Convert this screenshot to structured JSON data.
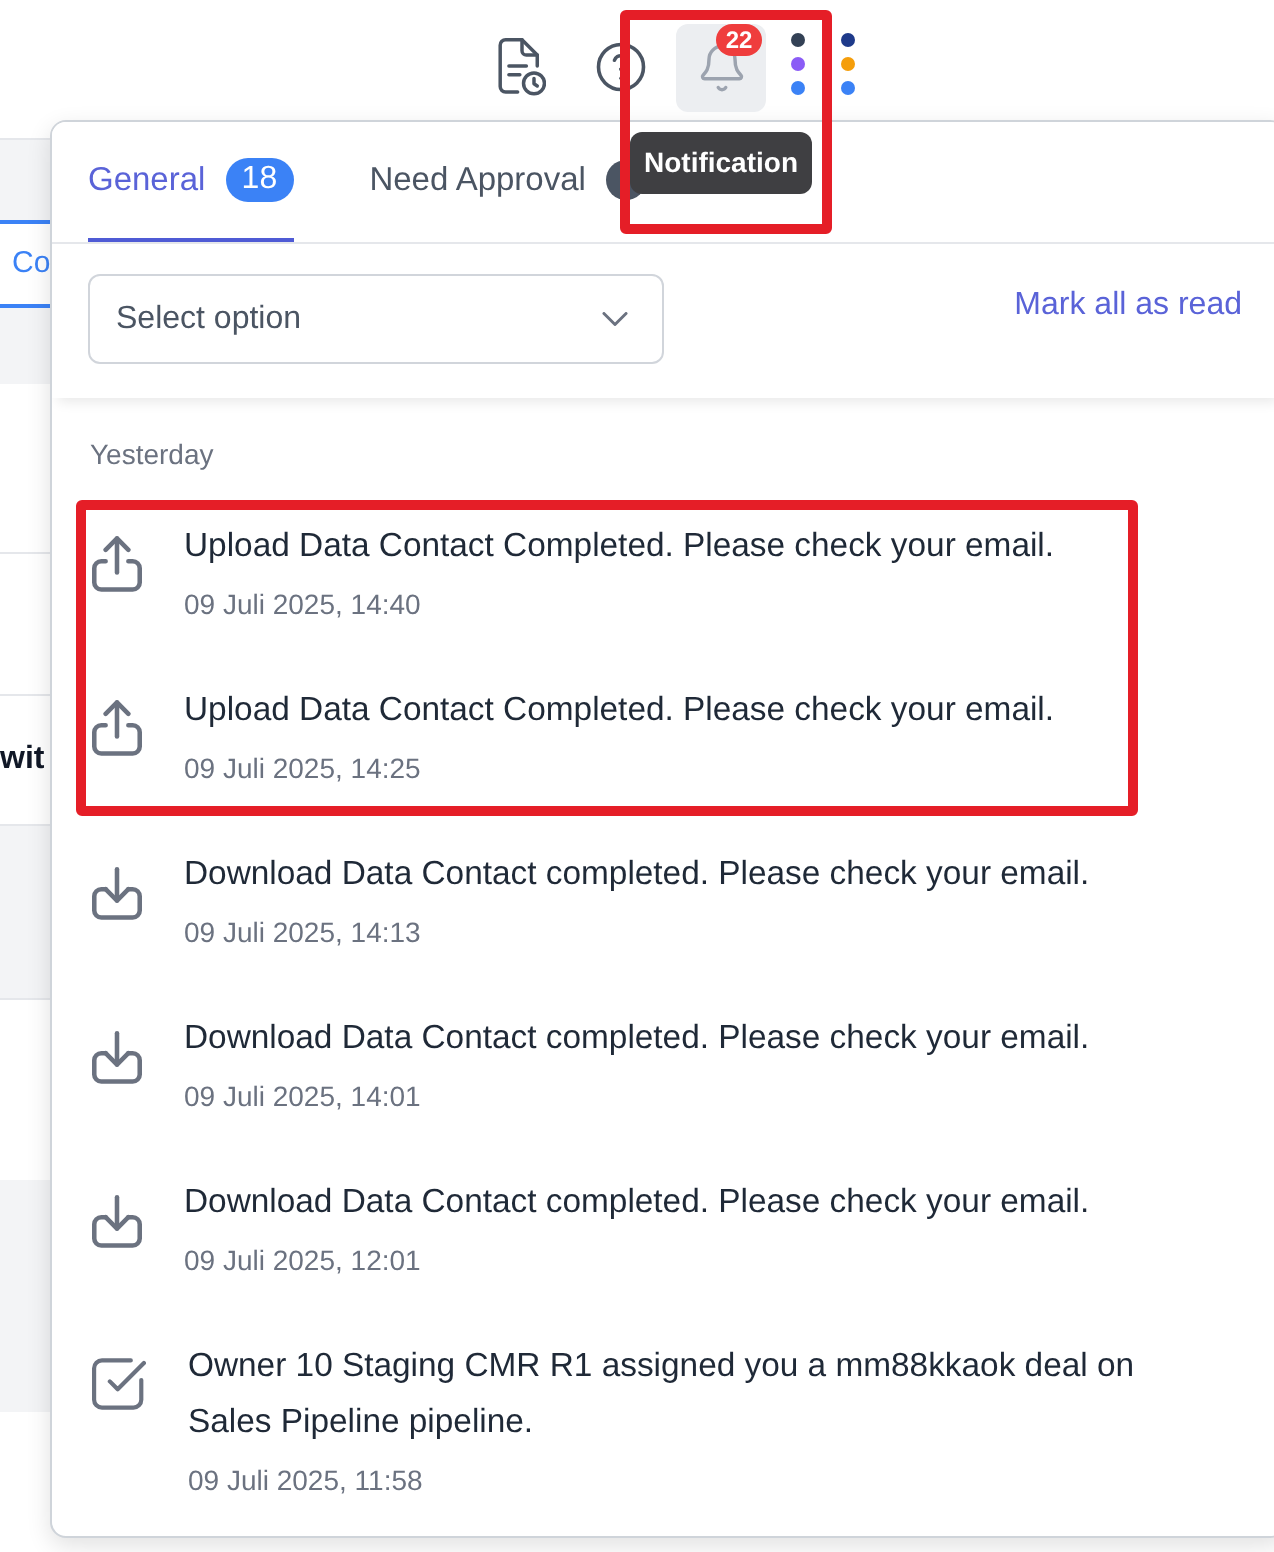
{
  "toolbar": {
    "notification_count": "22",
    "bell_selected": true,
    "bell_highlighted": true,
    "tooltip": "Notification"
  },
  "background_page": {
    "tab_fragment": "Co",
    "cell_fragment": "wit"
  },
  "notification_panel": {
    "tabs": [
      {
        "label": "General",
        "count": "18",
        "selected": true
      },
      {
        "label": "Need Approval",
        "badge": true,
        "selected": false
      }
    ],
    "filter": {
      "placeholder": "Select option"
    },
    "mark_all_read": "Mark all as read",
    "groups": [
      {
        "label": "Yesterday",
        "items": [
          {
            "kind": "upload",
            "title": "Upload Data Contact Completed. Please check your email.",
            "time": "09 Juli 2025, 14:40",
            "highlighted": true
          },
          {
            "kind": "upload",
            "title": "Upload Data Contact Completed. Please check your email.",
            "time": "09 Juli 2025, 14:25",
            "highlighted": true
          },
          {
            "kind": "download",
            "title": "Download Data Contact completed. Please check your email.",
            "time": "09 Juli 2025, 14:13",
            "highlighted": false
          },
          {
            "kind": "download",
            "title": "Download Data Contact completed. Please check your email.",
            "time": "09 Juli 2025, 14:01",
            "highlighted": false
          },
          {
            "kind": "download",
            "title": "Download Data Contact completed. Please check your email.",
            "time": "09 Juli 2025, 12:01",
            "highlighted": false
          },
          {
            "kind": "assigned",
            "title": "Owner 10 Staging CMR R1 assigned you a mm88kkaok deal on Sales Pipeline pipeline.",
            "time": "09 Juli 2025, 11:58",
            "highlighted": false
          }
        ]
      }
    ]
  }
}
